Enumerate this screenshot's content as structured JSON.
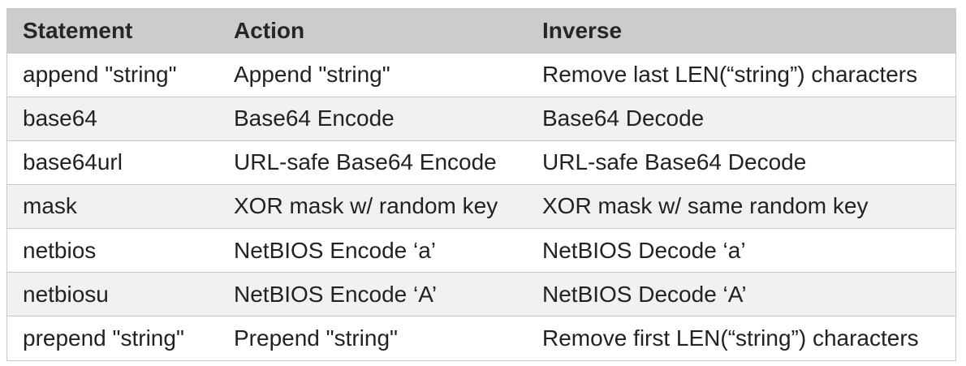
{
  "table": {
    "headers": [
      "Statement",
      "Action",
      "Inverse"
    ],
    "rows": [
      [
        "append \"string\"",
        "Append \"string\"",
        "Remove last LEN(“string”) characters"
      ],
      [
        "base64",
        "Base64 Encode",
        "Base64 Decode"
      ],
      [
        "base64url",
        "URL-safe Base64 Encode",
        "URL-safe Base64 Decode"
      ],
      [
        "mask",
        "XOR mask w/ random key",
        "XOR mask w/ same random key"
      ],
      [
        "netbios",
        "NetBIOS Encode ‘a’",
        "NetBIOS Decode ‘a’"
      ],
      [
        "netbiosu",
        "NetBIOS Encode ‘A’",
        "NetBIOS Decode ‘A’"
      ],
      [
        "prepend \"string\"",
        "Prepend \"string\"",
        "Remove first LEN(“string”) characters"
      ]
    ]
  }
}
